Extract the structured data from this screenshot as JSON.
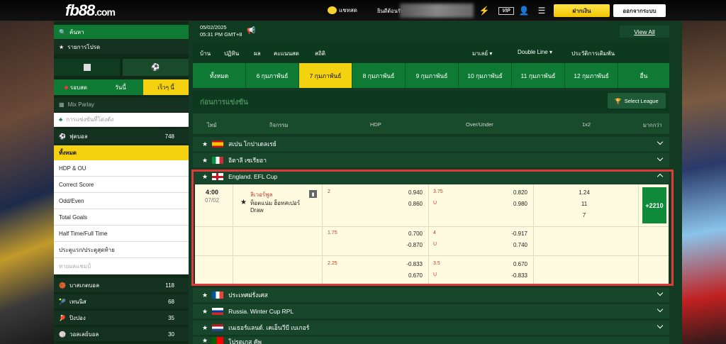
{
  "header": {
    "logo": "fb88",
    "logo_suffix": ".com",
    "chat_label": "แชทสด",
    "welcome": "ยินดีต้อนรับ,",
    "deposit_label": "ฝากเงิน",
    "logout_label": "ออกจากระบบ",
    "promo_icon_text": "VIP"
  },
  "sidebar": {
    "search": "ค้นหา",
    "favorites": "รายการโปรด",
    "tabs": [
      "รอบสด",
      "วันนี้",
      "เร็วๆ นี้"
    ],
    "mix_parlay": "Mix Parlay",
    "special": "การแข่งขันที่โด่งดัง",
    "football": {
      "label": "ฟุตบอล",
      "count": "748"
    },
    "bet_types": [
      "ทั้งหมด",
      "HDP & OU",
      "Correct Score",
      "Odd/Even",
      "Total Goals",
      "Half Time/Full Time",
      "ประตูแรก/ประตูสุดท้าย",
      "ทายผลแชมป์"
    ],
    "sports": [
      {
        "label": "บาสเกตบอล",
        "count": "118"
      },
      {
        "label": "เทนนิส",
        "count": "68"
      },
      {
        "label": "ปิงปอง",
        "count": "35"
      },
      {
        "label": "วอลเลย์บอล",
        "count": "30"
      }
    ]
  },
  "datebar": {
    "date": "05/02/2025",
    "time": "05:31 PM GMT+8",
    "view_all": "View All"
  },
  "subnav": {
    "items": [
      "บ้าน",
      "ปฏิทิน",
      "ผล",
      "คะแนนสด",
      "สถิติ"
    ],
    "dropdowns": [
      "มาเลย์",
      "Double Line",
      "ประวัติการเดิมพัน"
    ]
  },
  "day_tabs": [
    "ทั้งหมด",
    "6 กุมภาพันธ์",
    "7 กุมภาพันธ์",
    "8 กุมภาพันธ์",
    "9 กุมภาพันธ์",
    "10 กุมภาพันธ์",
    "11 กุมภาพันธ์",
    "12 กุมภาพันธ์",
    "อื่น"
  ],
  "section": {
    "title": "ก่อนการแข่งขัน",
    "select_league": "Select League"
  },
  "columns": [
    "ไทม์",
    "กิจกรรม",
    "HDP",
    "Over/Under",
    "1x2",
    "มากกว่า"
  ],
  "leagues_top": [
    {
      "name": "สเปน โกปาเดลเรย์",
      "flag": "spain"
    },
    {
      "name": "อิตาลี เซเรียอา",
      "flag": "italy"
    },
    {
      "name": "England. EFL Cup",
      "flag": "england"
    }
  ],
  "match": {
    "time": "4:00",
    "date": "07/02",
    "home": "ลิเวอร์พูล",
    "away": "ท็อตแน่ม ฮ็อทสเปอร์",
    "draw": "Draw",
    "more": "+2210",
    "rows": [
      {
        "hdp_line": "2",
        "hdp_top": "0.940",
        "hdp_bot": "0.860",
        "ou_line": "3.75",
        "ou_u": "U",
        "ou_top": "0.820",
        "ou_bot": "0.980"
      },
      {
        "hdp_line": "1.75",
        "hdp_top": "0.700",
        "hdp_bot": "-0.870",
        "ou_line": "4",
        "ou_u": "U",
        "ou_top": "-0.917",
        "ou_bot": "0.740"
      },
      {
        "hdp_line": "2.25",
        "hdp_top": "-0.833",
        "hdp_bot": "0.670",
        "ou_line": "3.5",
        "ou_u": "U",
        "ou_top": "0.670",
        "ou_bot": "-0.833"
      }
    ],
    "x12": [
      "1.24",
      "11",
      "7"
    ]
  },
  "leagues_bottom": [
    {
      "name": "ประเทศฝรั่งเศส",
      "flag": "france"
    },
    {
      "name": "Russia. Winter Cup RPL",
      "flag": "russia"
    },
    {
      "name": "เนเธอร์แลนด์. เคเอ็นวีบี เบเกอร์",
      "flag": "netherlands"
    },
    {
      "name": "โปรตุเกส คัพ",
      "flag": "portugal"
    }
  ],
  "colors": {
    "brand_green": "#0e7a34",
    "accent_yellow": "#f5d20f",
    "highlight_red": "#e03a3a"
  }
}
